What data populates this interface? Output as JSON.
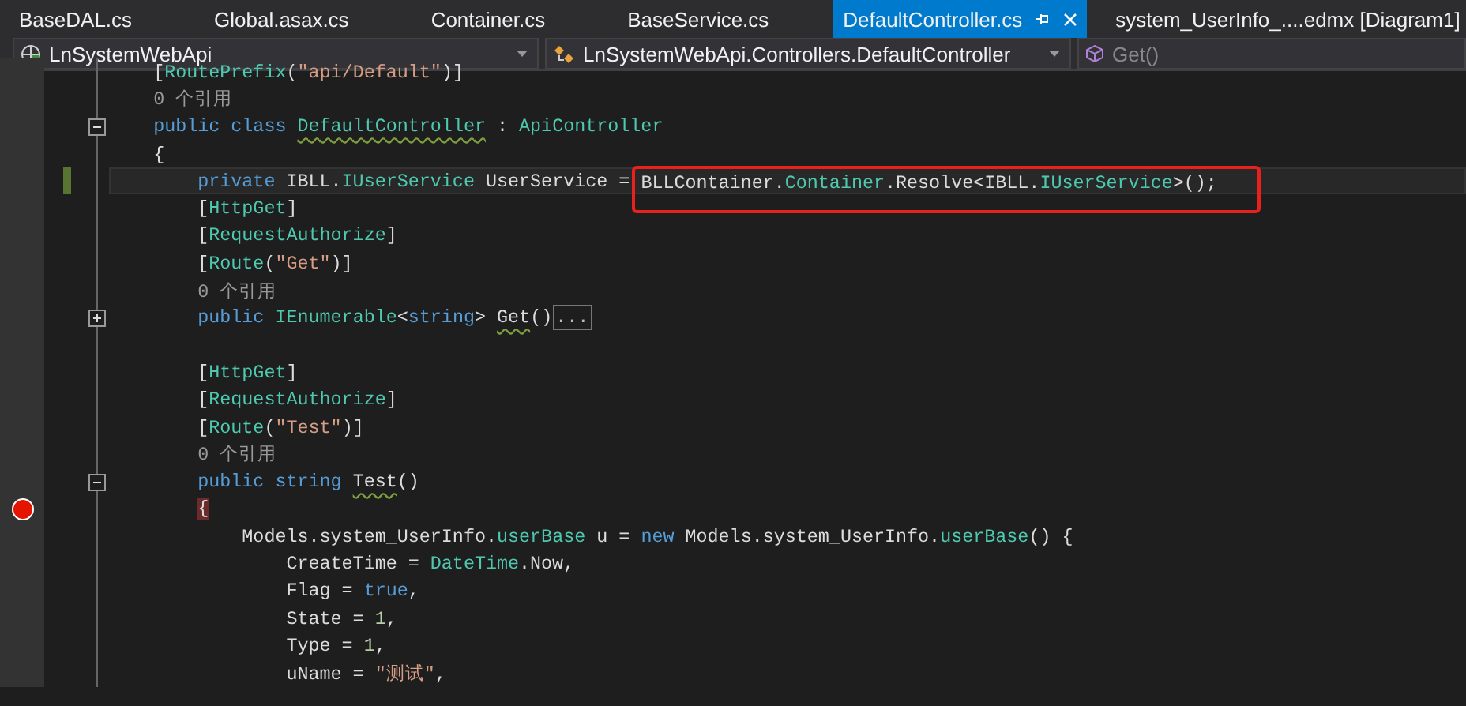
{
  "tabs": [
    {
      "label": "BaseDAL.cs",
      "selected": false
    },
    {
      "label": "Global.asax.cs",
      "selected": false
    },
    {
      "label": "Container.cs",
      "selected": false
    },
    {
      "label": "BaseService.cs",
      "selected": false
    },
    {
      "label": "DefaultController.cs",
      "selected": true
    },
    {
      "label": "system_UserInfo_....edmx [Diagram1]",
      "selected": false
    }
  ],
  "navigation_bar": [
    {
      "kind": "project",
      "label": "LnSystemWebApi",
      "disabled": false
    },
    {
      "kind": "class",
      "label": "LnSystemWebApi.Controllers.DefaultController",
      "disabled": false
    },
    {
      "kind": "method",
      "label": "Get()",
      "disabled": true
    }
  ],
  "editor": {
    "lines": [
      {
        "kind": "code",
        "tokens": [
          {
            "kind": "plain",
            "text": "    ["
          },
          {
            "kind": "type",
            "text": "RoutePrefix"
          },
          {
            "kind": "plain",
            "text": "("
          },
          {
            "kind": "string",
            "text": "\"api/Default\""
          },
          {
            "kind": "plain",
            "text": ")]"
          }
        ]
      },
      {
        "kind": "code",
        "tokens": [
          {
            "kind": "lens",
            "text": "    0 个引用"
          }
        ]
      },
      {
        "kind": "code",
        "expanded": true,
        "tokens": [
          {
            "kind": "keyword",
            "text": "    public class "
          },
          {
            "kind": "type_warn",
            "text": "DefaultController"
          },
          {
            "kind": "plain",
            "text": " : "
          },
          {
            "kind": "type",
            "text": "ApiController"
          }
        ]
      },
      {
        "kind": "code",
        "tokens": [
          {
            "kind": "plain",
            "text": "    {"
          }
        ]
      },
      {
        "kind": "code",
        "changed": true,
        "current": true,
        "tokens": [
          {
            "kind": "keyword",
            "text": "        private "
          },
          {
            "kind": "plain",
            "text": "IBLL."
          },
          {
            "kind": "type",
            "text": "IUserService"
          },
          {
            "kind": "plain",
            "text": " UserService = "
          }
        ],
        "callout": [
          {
            "kind": "plain",
            "text": "BLLContainer."
          },
          {
            "kind": "type",
            "text": "Container"
          },
          {
            "kind": "plain",
            "text": ".Resolve<IBLL."
          },
          {
            "kind": "type",
            "text": "IUserService"
          },
          {
            "kind": "plain",
            "text": ">();"
          }
        ]
      },
      {
        "kind": "code",
        "tokens": [
          {
            "kind": "plain",
            "text": "        ["
          },
          {
            "kind": "type",
            "text": "HttpGet"
          },
          {
            "kind": "plain",
            "text": "]"
          }
        ]
      },
      {
        "kind": "code",
        "tokens": [
          {
            "kind": "plain",
            "text": "        ["
          },
          {
            "kind": "type",
            "text": "RequestAuthorize"
          },
          {
            "kind": "plain",
            "text": "]"
          }
        ]
      },
      {
        "kind": "code",
        "tokens": [
          {
            "kind": "plain",
            "text": "        ["
          },
          {
            "kind": "type",
            "text": "Route"
          },
          {
            "kind": "plain",
            "text": "("
          },
          {
            "kind": "string",
            "text": "\"Get\""
          },
          {
            "kind": "plain",
            "text": ")]"
          }
        ]
      },
      {
        "kind": "code",
        "tokens": [
          {
            "kind": "lens",
            "text": "        0 个引用"
          }
        ]
      },
      {
        "kind": "code",
        "expanded": false,
        "tokens": [
          {
            "kind": "keyword",
            "text": "        public "
          },
          {
            "kind": "type",
            "text": "IEnumerable"
          },
          {
            "kind": "plain",
            "text": "<"
          },
          {
            "kind": "keyword",
            "text": "string"
          },
          {
            "kind": "plain",
            "text": "> "
          },
          {
            "kind": "warn",
            "text": "Get"
          },
          {
            "kind": "plain",
            "text": "()"
          }
        ],
        "collapsed": "..."
      },
      {
        "kind": "blank"
      },
      {
        "kind": "code",
        "tokens": [
          {
            "kind": "plain",
            "text": "        ["
          },
          {
            "kind": "type",
            "text": "HttpGet"
          },
          {
            "kind": "plain",
            "text": "]"
          }
        ]
      },
      {
        "kind": "code",
        "tokens": [
          {
            "kind": "plain",
            "text": "        ["
          },
          {
            "kind": "type",
            "text": "RequestAuthorize"
          },
          {
            "kind": "plain",
            "text": "]"
          }
        ]
      },
      {
        "kind": "code",
        "tokens": [
          {
            "kind": "plain",
            "text": "        ["
          },
          {
            "kind": "type",
            "text": "Route"
          },
          {
            "kind": "plain",
            "text": "("
          },
          {
            "kind": "string",
            "text": "\"Test\""
          },
          {
            "kind": "plain",
            "text": ")]"
          }
        ]
      },
      {
        "kind": "code",
        "tokens": [
          {
            "kind": "lens",
            "text": "        0 个引用"
          }
        ]
      },
      {
        "kind": "code",
        "expanded": true,
        "tokens": [
          {
            "kind": "keyword",
            "text": "        public string "
          },
          {
            "kind": "warn",
            "text": "Test"
          },
          {
            "kind": "plain",
            "text": "()"
          }
        ]
      },
      {
        "kind": "code",
        "breakpoint": true,
        "tokens": [
          {
            "kind": "brace_match",
            "text": "        {"
          }
        ]
      },
      {
        "kind": "code",
        "tokens": [
          {
            "kind": "plain",
            "text": "            Models.system_UserInfo."
          },
          {
            "kind": "type",
            "text": "userBase"
          },
          {
            "kind": "plain",
            "text": " u = "
          },
          {
            "kind": "keyword",
            "text": "new"
          },
          {
            "kind": "plain",
            "text": " Models.system_UserInfo."
          },
          {
            "kind": "type",
            "text": "userBase"
          },
          {
            "kind": "plain",
            "text": "() {"
          }
        ]
      },
      {
        "kind": "code",
        "tokens": [
          {
            "kind": "plain",
            "text": "                CreateTime = "
          },
          {
            "kind": "type",
            "text": "DateTime"
          },
          {
            "kind": "plain",
            "text": ".Now,"
          }
        ]
      },
      {
        "kind": "code",
        "tokens": [
          {
            "kind": "plain",
            "text": "                Flag = "
          },
          {
            "kind": "keyword",
            "text": "true"
          },
          {
            "kind": "plain",
            "text": ","
          }
        ]
      },
      {
        "kind": "code",
        "tokens": [
          {
            "kind": "plain",
            "text": "                State = "
          },
          {
            "kind": "number",
            "text": "1"
          },
          {
            "kind": "plain",
            "text": ","
          }
        ]
      },
      {
        "kind": "code",
        "tokens": [
          {
            "kind": "plain",
            "text": "                Type = "
          },
          {
            "kind": "number",
            "text": "1"
          },
          {
            "kind": "plain",
            "text": ","
          }
        ]
      },
      {
        "kind": "code",
        "tokens": [
          {
            "kind": "plain",
            "text": "                uName = "
          },
          {
            "kind": "string",
            "text": "\"测试\""
          },
          {
            "kind": "plain",
            "text": ","
          }
        ]
      }
    ]
  }
}
